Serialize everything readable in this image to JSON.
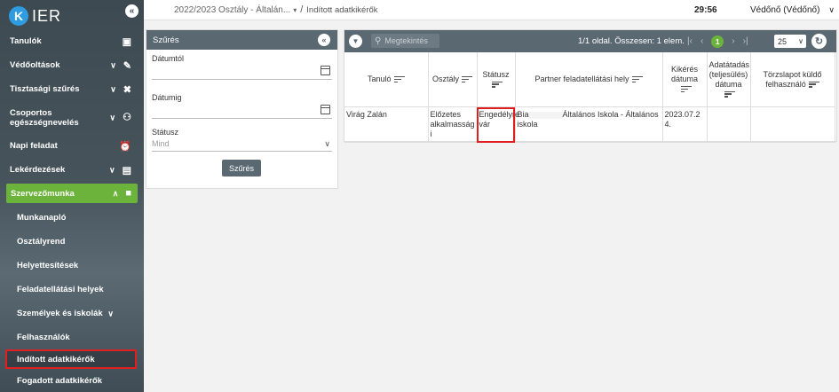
{
  "app": {
    "logo_mark": "K",
    "logo_text": "IER"
  },
  "sidebar": {
    "items": [
      {
        "label": "Tanulók",
        "icon": "id-card-icon",
        "chevron": false
      },
      {
        "label": "Védőoltások",
        "icon": "syringe-icon",
        "chevron": true
      },
      {
        "label": "Tisztasági szűrés",
        "icon": "bandage-icon",
        "chevron": true
      },
      {
        "label": "Csoportos egészségnevelés",
        "icon": "group-add-icon",
        "chevron": true
      },
      {
        "label": "Napi feladat",
        "icon": "alarm-icon",
        "chevron": false
      },
      {
        "label": "Lekérdezések",
        "icon": "clipboard-icon",
        "chevron": true
      },
      {
        "label": "Szervezőmunka",
        "icon": "briefcase-icon",
        "chevron": true,
        "active": true
      }
    ],
    "subitems": [
      "Munkanapló",
      "Osztályrend",
      "Helyettesítések",
      "Feladatellátási helyek",
      "Személyek és iskolák",
      "Felhasználók",
      "Indított adatkikérők",
      "Fogadott adatkikérők"
    ]
  },
  "topbar": {
    "class_select": "2022/2023 Osztály - Általán...",
    "separator": "/",
    "page": "Indított adatkikérők",
    "timer": "29:56",
    "user": "Védőnő (Védőnő)"
  },
  "filter": {
    "title": "Szűrés",
    "fields": [
      {
        "label": "Dátumtól"
      },
      {
        "label": "Dátumig"
      }
    ],
    "status_label": "Státusz",
    "status_value": "Mind",
    "button": "Szűrés"
  },
  "table": {
    "search_placeholder": "Megtekintés",
    "paging_text": "1/1 oldal. Összesen: 1 elem.",
    "current_page": "1",
    "per_page": "25",
    "columns": [
      "Tanuló",
      "Osztály",
      "Státusz",
      "Partner feladatellátási hely",
      "Kikérés dátuma",
      "Adatátadás (teljesülés) dátuma",
      "Törzslapot küldő felhasználó"
    ],
    "rows": [
      {
        "student": "Virág Zalán",
        "class": "Előzetes alkalmasság i",
        "status": "Engedélyre vár",
        "partner_prefix": "Bia",
        "partner_suffix": "Általános Iskola - Általános iskola",
        "request_date": "2023.07.24.",
        "transfer_date": "",
        "sender": ""
      }
    ]
  }
}
